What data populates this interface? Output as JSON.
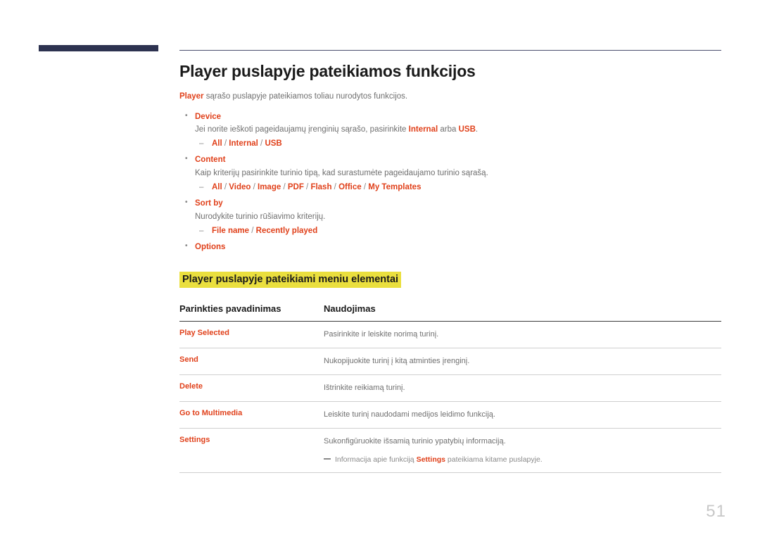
{
  "document": {
    "page_number": "51",
    "accent_color": "#e0401a",
    "navy_color": "#2d3250",
    "highlight_color": "#eadf3e",
    "body_text_color": "#6f6f6f"
  },
  "title": "Player puslapyje pateikiamos funkcijos",
  "intro": {
    "accent": "Player",
    "rest": " sąrašo puslapyje pateikiamos toliau nurodytos funkcijos."
  },
  "bullets": [
    {
      "label": "Device",
      "desc_pre": "Jei norite ieškoti pageidaujamų įrenginių sąrašo, pasirinkite ",
      "desc_accent1": "Internal",
      "desc_mid": " arba ",
      "desc_accent2": "USB",
      "desc_post": ".",
      "options": [
        "All",
        "Internal",
        "USB"
      ]
    },
    {
      "label": "Content",
      "desc_pre": "Kaip kriterijų pasirinkite turinio tipą, kad surastumėte pageidaujamo turinio sąrašą.",
      "desc_accent1": "",
      "desc_mid": "",
      "desc_accent2": "",
      "desc_post": "",
      "options": [
        "All",
        "Video",
        "Image",
        "PDF",
        "Flash",
        "Office",
        "My Templates"
      ]
    },
    {
      "label": "Sort by",
      "desc_pre": "Nurodykite turinio rūšiavimo kriterijų.",
      "desc_accent1": "",
      "desc_mid": "",
      "desc_accent2": "",
      "desc_post": "",
      "options": [
        "File name",
        "Recently played"
      ]
    },
    {
      "label": "Options",
      "desc_pre": "",
      "desc_accent1": "",
      "desc_mid": "",
      "desc_accent2": "",
      "desc_post": "",
      "options": []
    }
  ],
  "sub_heading": "Player puslapyje pateikiami meniu elementai",
  "table": {
    "headers": {
      "name": "Parinkties pavadinimas",
      "usage": "Naudojimas"
    },
    "rows": [
      {
        "name": "Play Selected",
        "usage": "Pasirinkite ir leiskite norimą turinį.",
        "note_pre": "",
        "note_accent": "",
        "note_post": ""
      },
      {
        "name": "Send",
        "usage": "Nukopijuokite turinį į kitą atminties įrenginį.",
        "note_pre": "",
        "note_accent": "",
        "note_post": ""
      },
      {
        "name": "Delete",
        "usage": "Ištrinkite reikiamą turinį.",
        "note_pre": "",
        "note_accent": "",
        "note_post": ""
      },
      {
        "name": "Go to Multimedia",
        "usage": "Leiskite turinį naudodami medijos leidimo funkciją.",
        "note_pre": "",
        "note_accent": "",
        "note_post": ""
      },
      {
        "name": "Settings",
        "usage": "Sukonfigūruokite išsamią turinio ypatybių informaciją.",
        "note_pre": "Informacija apie funkciją ",
        "note_accent": "Settings",
        "note_post": " pateikiama kitame puslapyje."
      }
    ]
  }
}
